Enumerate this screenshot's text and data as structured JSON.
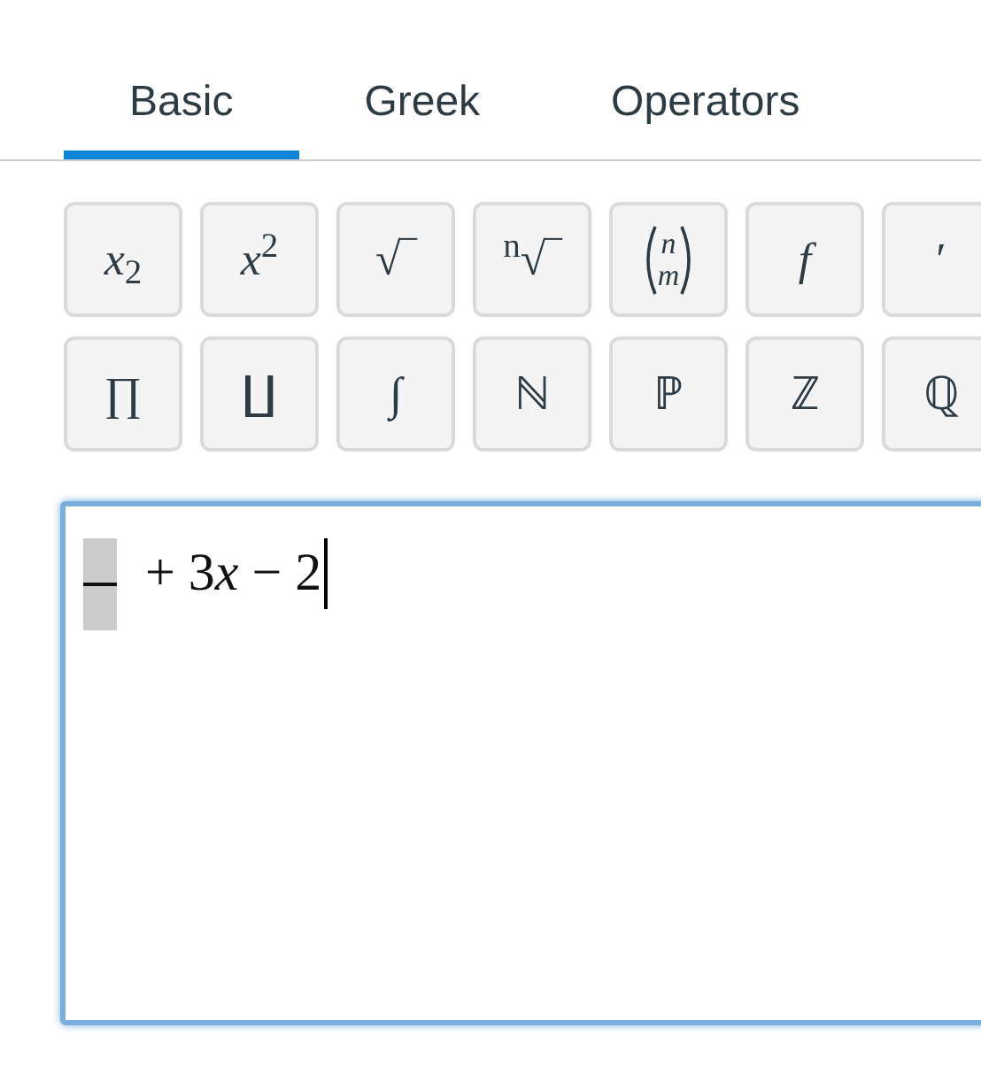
{
  "tabs": [
    {
      "label": "Basic",
      "selected": true
    },
    {
      "label": "Greek",
      "selected": false
    },
    {
      "label": "Operators",
      "selected": false
    }
  ],
  "toolbar_rows": [
    [
      {
        "kind": "text",
        "label": "*x*$_{2}$"
      },
      {
        "kind": "text",
        "label": "*x*$^{2}$"
      },
      {
        "kind": "text",
        "label": "√‾"
      },
      {
        "kind": "text",
        "label": "$^{n}$√‾"
      },
      {
        "kind": "binom",
        "top": "n",
        "bottom": "m"
      },
      {
        "kind": "text",
        "label": "*f*"
      },
      {
        "kind": "text",
        "label": "′"
      }
    ],
    [
      {
        "kind": "text",
        "label": "∏"
      },
      {
        "kind": "text",
        "label": "∐"
      },
      {
        "kind": "text",
        "label": "∫"
      },
      {
        "kind": "text",
        "label": "ℕ"
      },
      {
        "kind": "text",
        "label": "ℙ"
      },
      {
        "kind": "text",
        "label": "ℤ"
      },
      {
        "kind": "text",
        "label": "ℚ"
      }
    ]
  ],
  "editor": {
    "empty_slot": true,
    "value": [
      {
        "text": "+ 3",
        "italic": false
      },
      {
        "text": "x",
        "italic": true
      },
      {
        "text": " − 2",
        "italic": false
      }
    ],
    "focused": true
  }
}
